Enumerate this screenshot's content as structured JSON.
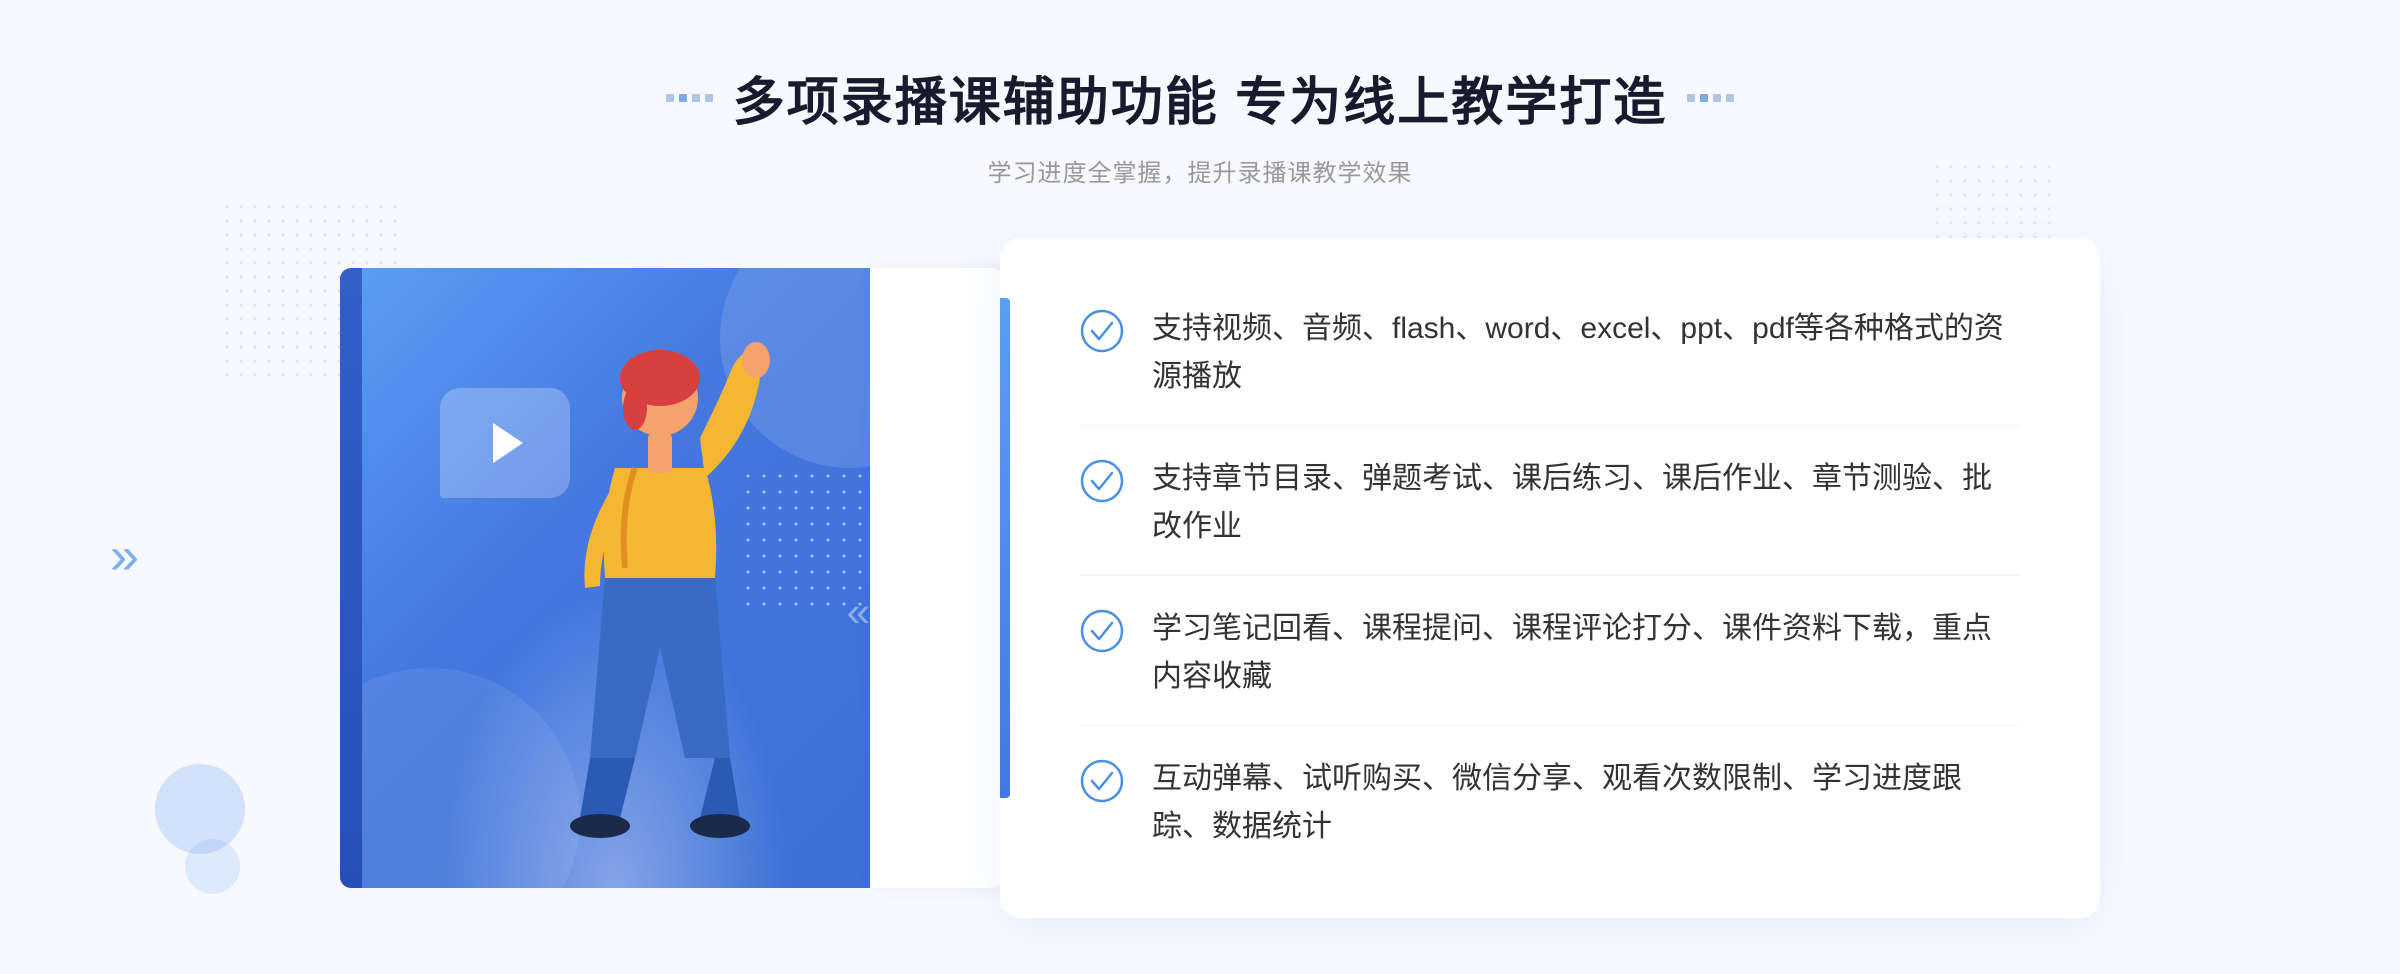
{
  "page": {
    "background_color": "#f8f9ff"
  },
  "header": {
    "title": "多项录播课辅助功能 专为线上教学打造",
    "subtitle": "学习进度全掌握，提升录播课教学效果",
    "title_decoration_left": "❖",
    "title_decoration_right": "❖"
  },
  "features": [
    {
      "id": 1,
      "text": "支持视频、音频、flash、word、excel、ppt、pdf等各种格式的资源播放"
    },
    {
      "id": 2,
      "text": "支持章节目录、弹题考试、课后练习、课后作业、章节测验、批改作业"
    },
    {
      "id": 3,
      "text": "学习笔记回看、课程提问、课程评论打分、课件资料下载，重点内容收藏"
    },
    {
      "id": 4,
      "text": "互动弹幕、试听购买、微信分享、观看次数限制、学习进度跟踪、数据统计"
    }
  ],
  "illustration": {
    "play_icon": "▶",
    "arrow_decoration": "»"
  }
}
